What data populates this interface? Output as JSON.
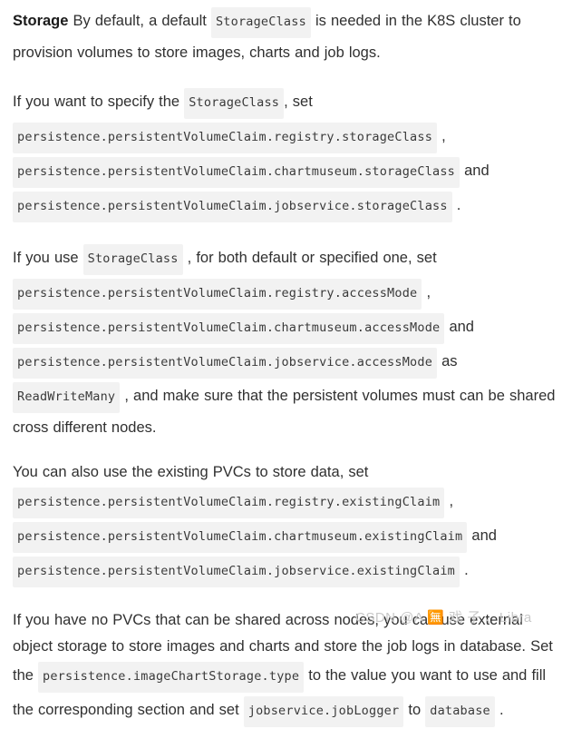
{
  "document": {
    "paragraphs": [
      {
        "id": "storage-intro",
        "heading": "Storage",
        "parts": [
          {
            "t": "text",
            "v": " By default, a default "
          },
          {
            "t": "code",
            "v": "StorageClass"
          },
          {
            "t": "text",
            "v": " is needed in the K8S cluster to provision volumes to store images, charts and job logs."
          }
        ]
      },
      {
        "id": "specify-storageclass",
        "parts": [
          {
            "t": "text",
            "v": "If you want to specify the "
          },
          {
            "t": "code",
            "v": "StorageClass"
          },
          {
            "t": "text",
            "v": ", set "
          },
          {
            "t": "code",
            "v": "persistence.persistentVolumeClaim.registry.storageClass"
          },
          {
            "t": "text",
            "v": " , "
          },
          {
            "t": "code",
            "v": "persistence.persistentVolumeClaim.chartmuseum.storageClass"
          },
          {
            "t": "text",
            "v": " and "
          },
          {
            "t": "code",
            "v": "persistence.persistentVolumeClaim.jobservice.storageClass"
          },
          {
            "t": "text",
            "v": " ."
          }
        ]
      },
      {
        "id": "accessmode",
        "parts": [
          {
            "t": "text",
            "v": "If you use "
          },
          {
            "t": "code",
            "v": "StorageClass"
          },
          {
            "t": "text",
            "v": " , for both default or specified one, set "
          },
          {
            "t": "code",
            "v": "persistence.persistentVolumeClaim.registry.accessMode"
          },
          {
            "t": "text",
            "v": " , "
          },
          {
            "t": "code",
            "v": "persistence.persistentVolumeClaim.chartmuseum.accessMode"
          },
          {
            "t": "text",
            "v": " and "
          },
          {
            "t": "code",
            "v": "persistence.persistentVolumeClaim.jobservice.accessMode"
          },
          {
            "t": "text",
            "v": " as "
          },
          {
            "t": "code",
            "v": "ReadWriteMany"
          },
          {
            "t": "text",
            "v": " , and make sure that the persistent volumes must can be shared cross different nodes."
          }
        ]
      },
      {
        "id": "existing-pvc",
        "parts": [
          {
            "t": "text",
            "v": "You can also use the existing PVCs to store data, set "
          },
          {
            "t": "code",
            "v": "persistence.persistentVolumeClaim.registry.existingClaim"
          },
          {
            "t": "text",
            "v": " , "
          },
          {
            "t": "code",
            "v": "persistence.persistentVolumeClaim.chartmuseum.existingClaim"
          },
          {
            "t": "text",
            "v": " and "
          },
          {
            "t": "code",
            "v": "persistence.persistentVolumeClaim.jobservice.existingClaim"
          },
          {
            "t": "text",
            "v": " ."
          }
        ]
      },
      {
        "id": "no-pvc",
        "parts": [
          {
            "t": "text",
            "v": "If you have no PVCs that can be shared across nodes, you can use external object storage to store images and charts and store the job logs in database. Set the "
          },
          {
            "t": "code",
            "v": "persistence.imageChartStorage.type"
          },
          {
            "t": "text",
            "v": " to the value you want to use and fill the corresponding section and set "
          },
          {
            "t": "code",
            "v": "jobservice.jobLogger"
          },
          {
            "t": "text",
            "v": " to "
          },
          {
            "t": "code",
            "v": "database"
          },
          {
            "t": "text",
            "v": " ."
          }
        ]
      }
    ],
    "watermark": "CSDN @A 🈚 戏 子 、Libra"
  }
}
